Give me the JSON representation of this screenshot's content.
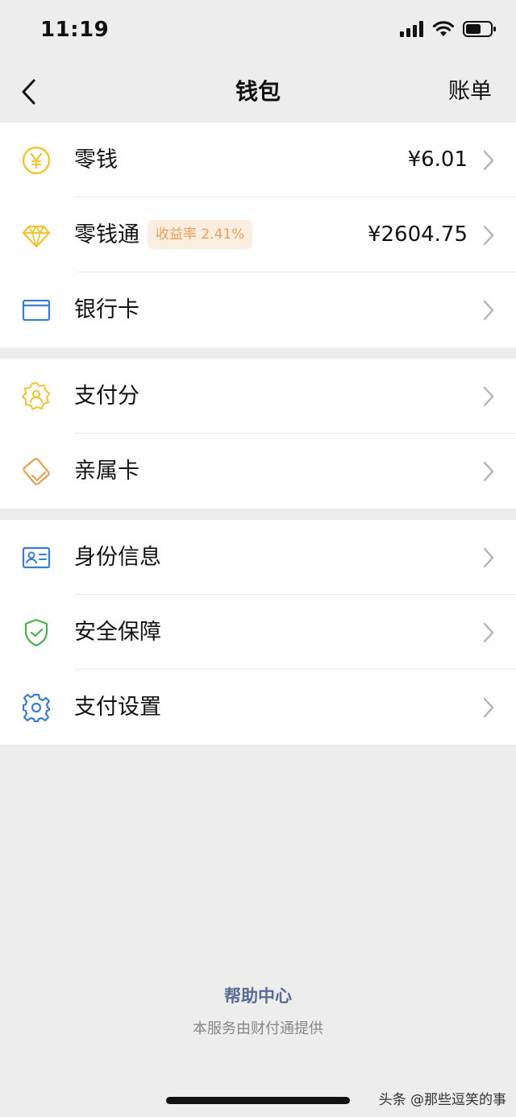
{
  "status_bar": {
    "time": "11:19"
  },
  "nav": {
    "title": "钱包",
    "right_label": "账单"
  },
  "groups": [
    {
      "items": [
        {
          "label": "零钱",
          "value": "¥6.01",
          "icon": "coin-yen-icon"
        },
        {
          "label": "零钱通",
          "badge": "收益率 2.41%",
          "value": "¥2604.75",
          "icon": "diamond-icon"
        },
        {
          "label": "银行卡",
          "value": "",
          "icon": "bank-card-icon"
        }
      ]
    },
    {
      "items": [
        {
          "label": "支付分",
          "icon": "badge-person-icon"
        },
        {
          "label": "亲属卡",
          "icon": "family-card-icon"
        }
      ]
    },
    {
      "items": [
        {
          "label": "身份信息",
          "icon": "id-card-icon"
        },
        {
          "label": "安全保障",
          "icon": "shield-check-icon"
        },
        {
          "label": "支付设置",
          "icon": "gear-icon"
        }
      ]
    }
  ],
  "footer": {
    "help_link": "帮助中心",
    "provider_note": "本服务由财付通提供"
  },
  "watermark": "头条 @那些逗笑的事",
  "colors": {
    "background": "#ededed",
    "link": "#576b95",
    "badge_bg": "#fbeee0",
    "badge_text": "#e5a25e",
    "icon_yellow": "#f1c232",
    "icon_blue": "#3a7bd5",
    "icon_green": "#4caf50",
    "icon_orange": "#e0a050"
  }
}
